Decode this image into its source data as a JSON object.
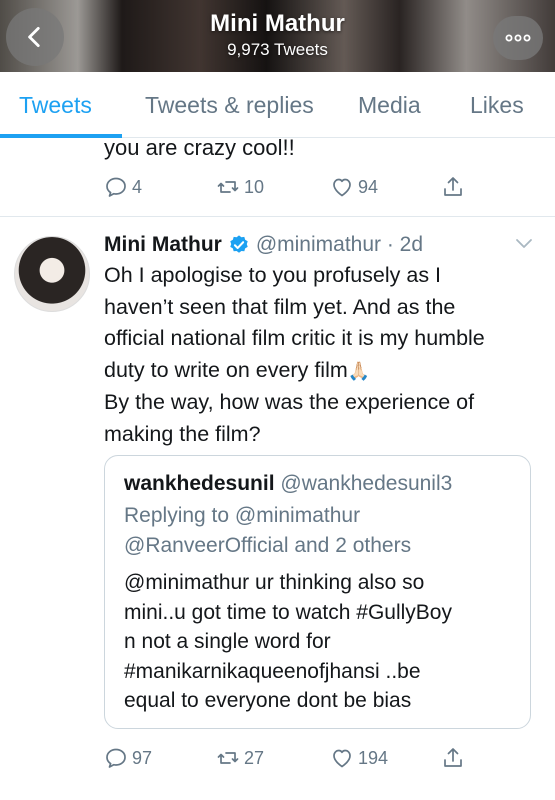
{
  "header": {
    "title": "Mini Mathur",
    "subtitle": "9,973 Tweets"
  },
  "tabs": [
    {
      "label": "Tweets",
      "active": true
    },
    {
      "label": "Tweets & replies",
      "active": false
    },
    {
      "label": "Media",
      "active": false
    },
    {
      "label": "Likes",
      "active": false
    }
  ],
  "previous_tweet": {
    "text_tail": "you are crazy cool!!",
    "reply_count": "4",
    "retweet_count": "10",
    "like_count": "94"
  },
  "tweet": {
    "author_name": "Mini Mathur",
    "handle_time": "@minimathur · 2d",
    "verified": true,
    "text": "Oh I apologise to you profusely as I\nhaven’t seen that film yet. And as  the\nofficial national film critic it is my humble\nduty to write on every film",
    "emoji": "🙏🏻",
    "text2": "By the way, how was the experience of\nmaking the film?",
    "reply_count": "97",
    "retweet_count": "27",
    "like_count": "194"
  },
  "quoted_tweet": {
    "author_name": "wankhedesunil",
    "handle": "@wankhedesunil3",
    "replying_line1": "Replying to @minimathur",
    "replying_line2": "@RanveerOfficial and 2 others",
    "text": "@minimathur ur thinking also so\nmini..u got time to watch #GullyBoy\nn not a single word for\n#manikarnikaqueenofjhansi  ..be\nequal to everyone dont be bias"
  },
  "colors": {
    "accent": "#1da1f2",
    "muted": "#657786",
    "divider": "#e1e8ed"
  },
  "icons": [
    "back-arrow-icon",
    "more-dots-icon",
    "reply-icon",
    "retweet-icon",
    "like-icon",
    "share-icon",
    "verified-badge-icon",
    "chevron-down-icon"
  ]
}
